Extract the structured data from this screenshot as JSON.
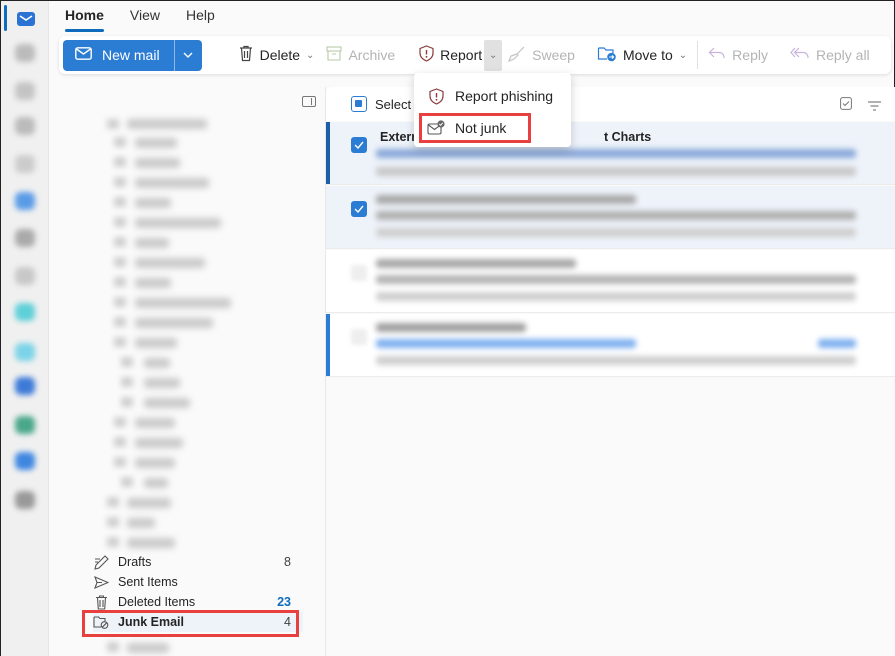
{
  "tabs": [
    {
      "label": "Home",
      "active": true
    },
    {
      "label": "View",
      "active": false
    },
    {
      "label": "Help",
      "active": false
    }
  ],
  "ribbon": {
    "new_mail": "New mail",
    "delete": "Delete",
    "archive": "Archive",
    "report": "Report",
    "sweep": "Sweep",
    "move_to": "Move to",
    "reply": "Reply",
    "reply_all": "Reply all"
  },
  "report_menu": {
    "items": [
      {
        "label": "Report phishing",
        "icon": "shield-alert-icon"
      },
      {
        "label": "Not junk",
        "icon": "mail-checkmark-icon",
        "highlighted": true
      }
    ]
  },
  "folders": {
    "items": [
      {
        "label": "Drafts",
        "count": "8",
        "icon": "drafts-pencil-icon"
      },
      {
        "label": "Sent Items",
        "count": "",
        "icon": "send-icon"
      },
      {
        "label": "Deleted Items",
        "count": "23",
        "icon": "trash-icon",
        "count_color": "#0f6cbd"
      },
      {
        "label": "Junk Email",
        "count": "4",
        "icon": "junk-folder-icon",
        "selected": true,
        "highlighted": true
      }
    ]
  },
  "message_list": {
    "select_label": "Select",
    "messages": [
      {
        "sender_visible": "Extern",
        "subject_visible": "t Charts",
        "checked": true,
        "selected": true
      },
      {
        "checked": true,
        "selected": true
      },
      {
        "checked": false,
        "selected": false
      },
      {
        "checked": false,
        "selected": false,
        "unread": true
      }
    ]
  },
  "colors": {
    "accent": "#2b7cd3",
    "highlight_box": "#e8403f",
    "count_blue": "#0f6cbd"
  }
}
